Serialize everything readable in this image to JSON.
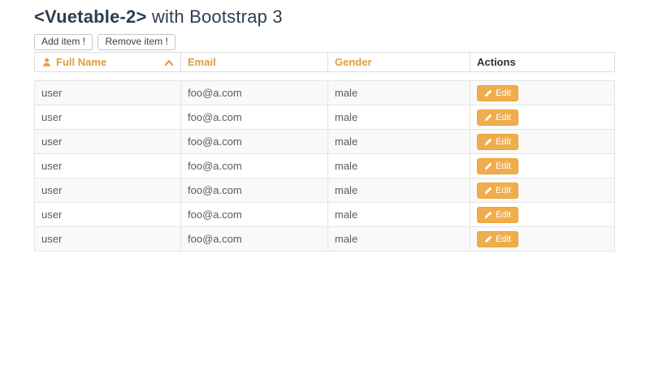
{
  "title": {
    "highlight": "<Vuetable-2>",
    "rest": " with Bootstrap 3"
  },
  "toolbar": {
    "add_button": "Add item !",
    "remove_button": "Remove item !"
  },
  "table": {
    "columns": [
      {
        "label": "Full Name",
        "icon": "user-icon",
        "sortable": true,
        "sorted": "asc"
      },
      {
        "label": "Email",
        "sortable": true
      },
      {
        "label": "Gender",
        "sortable": true
      },
      {
        "label": "Actions",
        "sortable": false
      }
    ],
    "rows": [
      {
        "name": "user",
        "email": "foo@a.com",
        "gender": "male",
        "action_label": "Edit"
      },
      {
        "name": "user",
        "email": "foo@a.com",
        "gender": "male",
        "action_label": "Edit"
      },
      {
        "name": "user",
        "email": "foo@a.com",
        "gender": "male",
        "action_label": "Edit"
      },
      {
        "name": "user",
        "email": "foo@a.com",
        "gender": "male",
        "action_label": "Edit"
      },
      {
        "name": "user",
        "email": "foo@a.com",
        "gender": "male",
        "action_label": "Edit"
      },
      {
        "name": "user",
        "email": "foo@a.com",
        "gender": "male",
        "action_label": "Edit"
      },
      {
        "name": "user",
        "email": "foo@a.com",
        "gender": "male",
        "action_label": "Edit"
      }
    ]
  },
  "colors": {
    "title": "#2c3e50",
    "header_accent": "#e09c3e",
    "edit_button": "#f0ad4e",
    "edit_button_border": "#eea236",
    "row_stripe": "#f9f9f9",
    "border": "#dddddd",
    "cell_text": "#555c63"
  }
}
